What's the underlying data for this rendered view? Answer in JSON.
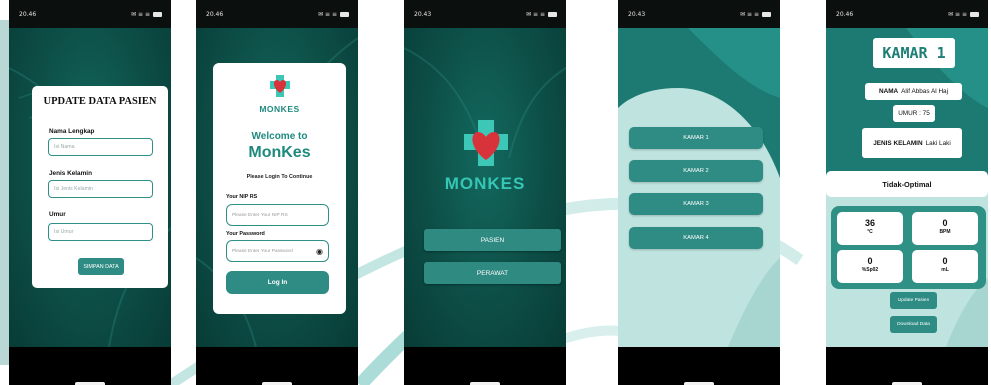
{
  "phones": [
    {
      "status_time": "20.46",
      "status_icons": "✉ ≡ ≡",
      "title": "UPDATE DATA PASIEN",
      "fields": [
        {
          "label": "Nama Lengkap",
          "placeholder": "Isi Nama"
        },
        {
          "label": "Jenis Kelamin",
          "placeholder": "Isi Jenis Kelamin"
        },
        {
          "label": "Umur",
          "placeholder": "Isi Umur"
        }
      ],
      "button": "SIMPAN DATA"
    },
    {
      "status_time": "20.46",
      "status_icons": "✉ ≡ ≡",
      "logo_text": "MONKES",
      "welcome": "Welcome to",
      "app_name": "MonKes",
      "subtitle": "Please Login To Continue",
      "nip_label": "Your NIP RS",
      "nip_placeholder": "Please Enter Your NIP RS",
      "password_label": "Your Password",
      "password_placeholder": "Please Enter Your Password",
      "login_button": "Log In"
    },
    {
      "status_time": "20.43",
      "status_icons": "✉ ≡ ≡",
      "brand": "MONKES",
      "buttons": [
        "PASIEN",
        "PERAWAT"
      ]
    },
    {
      "status_time": "20.43",
      "status_icons": "✉ ≡ ≡",
      "rooms": [
        "KAMAR 1",
        "KAMAR 2",
        "KAMAR 3",
        "KAMAR 4"
      ]
    },
    {
      "status_time": "20.46",
      "status_icons": "✉ ≡ ≡",
      "title": "KAMAR 1",
      "nama_label": "NAMA",
      "nama_value": "Alif Abbas Al Haj",
      "umur": "UMUR : 75",
      "jk_label": "JENIS KELAMIN",
      "jk_value": "Laki Laki",
      "status": "Tidak-Optimal",
      "vitals": [
        {
          "value": "36",
          "unit": "°C"
        },
        {
          "value": "0",
          "unit": "BPM"
        },
        {
          "value": "0",
          "unit": "%Sp02"
        },
        {
          "value": "0",
          "unit": "mL"
        }
      ],
      "update_button": "Update Pasien",
      "download_button": "Download Data"
    }
  ],
  "colors": {
    "teal_dark": "#0d5048",
    "teal_button": "#2f8c84",
    "mint": "#bfe3df",
    "heart": "#d8323a",
    "cross": "#3cc7b6"
  }
}
